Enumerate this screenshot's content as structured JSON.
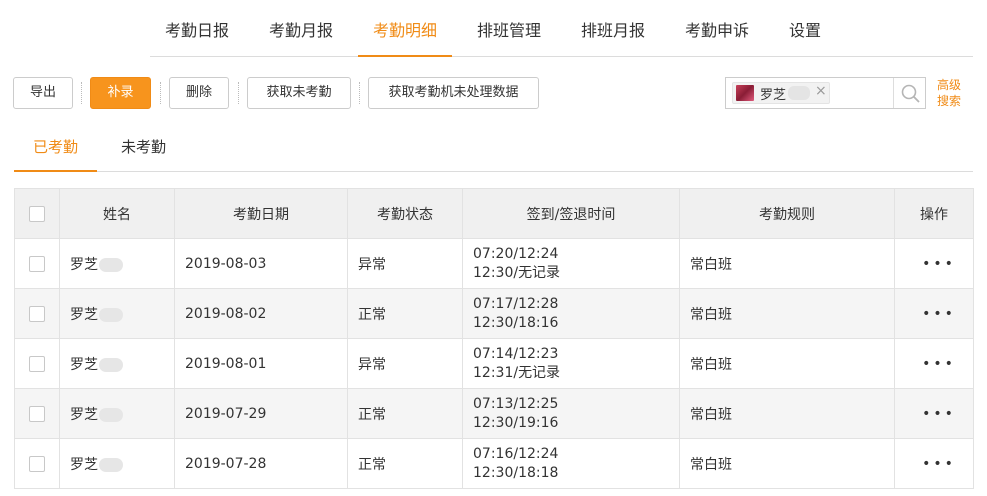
{
  "nav": {
    "tabs": [
      "考勤日报",
      "考勤月报",
      "考勤明细",
      "排班管理",
      "排班月报",
      "考勤申诉",
      "设置"
    ],
    "active": "考勤明细"
  },
  "toolbar": {
    "export": "导出",
    "supplement": "补录",
    "delete": "删除",
    "fetch_absent": "获取未考勤",
    "fetch_machine": "获取考勤机未处理数据"
  },
  "search": {
    "tag_name": "罗芝",
    "tag_close": "×",
    "advanced": "高级搜索"
  },
  "subtabs": [
    "已考勤",
    "未考勤"
  ],
  "table": {
    "headers": [
      "姓名",
      "考勤日期",
      "考勤状态",
      "签到/签退时间",
      "考勤规则",
      "操作"
    ],
    "rows": [
      {
        "name": "罗芝",
        "date": "2019-08-03",
        "status": "异常",
        "time1": "07:20/12:24",
        "time2": "12:30/无记录",
        "rule": "常白班",
        "ops": "•••"
      },
      {
        "name": "罗芝",
        "date": "2019-08-02",
        "status": "正常",
        "time1": "07:17/12:28",
        "time2": "12:30/18:16",
        "rule": "常白班",
        "ops": "•••"
      },
      {
        "name": "罗芝",
        "date": "2019-08-01",
        "status": "异常",
        "time1": "07:14/12:23",
        "time2": "12:31/无记录",
        "rule": "常白班",
        "ops": "•••"
      },
      {
        "name": "罗芝",
        "date": "2019-07-29",
        "status": "正常",
        "time1": "07:13/12:25",
        "time2": "12:30/19:16",
        "rule": "常白班",
        "ops": "•••"
      },
      {
        "name": "罗芝",
        "date": "2019-07-28",
        "status": "正常",
        "time1": "07:16/12:24",
        "time2": "12:30/18:18",
        "rule": "常白班",
        "ops": "•••"
      }
    ]
  },
  "colors": {
    "accent": "#f08b16",
    "primary_button": "#f7941d"
  }
}
